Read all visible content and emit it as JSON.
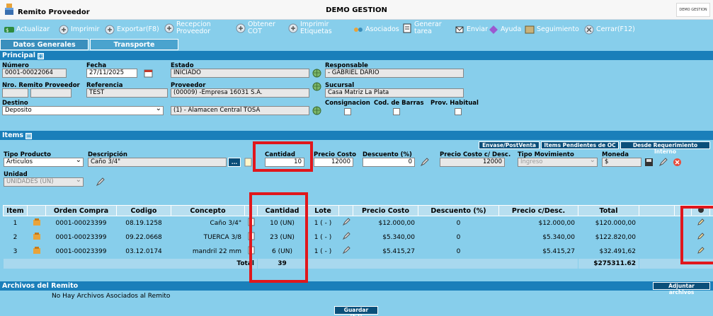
{
  "window": {
    "title": "Remito Proveedor",
    "center_title": "DEMO GESTION",
    "brand_text": "DEMO GESTION"
  },
  "toolbar": {
    "actualizar": "Actualizar",
    "imprimir": "Imprimir",
    "exportar": "Exportar(F8)",
    "recepcion_1": "Recepcion",
    "recepcion_2": "Proveedor",
    "obtener_1": "Obtener",
    "obtener_2": "COT",
    "imprimir_et_1": "Imprimir",
    "imprimir_et_2": "Etiquetas",
    "asociados": "Asociados",
    "generar_1": "Generar",
    "generar_2": "tarea",
    "enviar": "Enviar",
    "ayuda": "Ayuda",
    "seguimiento": "Seguimiento",
    "cerrar": "Cerrar(F12)"
  },
  "tabs": [
    "Datos Generales",
    "Transporte"
  ],
  "principal": {
    "section_label": "Principal",
    "numero_label": "Número",
    "numero": "0001-00022064",
    "fecha_label": "Fecha",
    "fecha": "27/11/2025",
    "estado_label": "Estado",
    "estado": "INICIADO",
    "responsable_label": "Responsable",
    "responsable": "- GABRIEL DARIO",
    "nro_remito_label": "Nro. Remito Proveedor",
    "referencia_label": "Referencia",
    "referencia": "TEST",
    "proveedor_label": "Proveedor",
    "proveedor": "(00009) -Empresa 16031 S.A.",
    "sucursal_label": "Sucursal",
    "sucursal": "Casa Matriz La Plata",
    "destino_label": "Destino",
    "destino": "Deposito",
    "almacen": "(1) - Alamacen Central TOSA",
    "consignacion_label": "Consignacion",
    "cod_barras_label": "Cod. de Barras",
    "prov_habitual_label": "Prov. Habitual"
  },
  "items": {
    "section_label": "Items",
    "btn_envase": "Envase/PostVenta",
    "btn_pendientes": "Items Pendientes de OC",
    "btn_requerimiento": "Desde Requerimiento Interno",
    "tipo_producto_label": "Tipo Producto",
    "tipo_producto": "Articulos",
    "descripcion_label": "Descripción",
    "descripcion": "Caño 3/4\"",
    "descripcion_btn": "...",
    "cantidad_label": "Cantidad",
    "cantidad": "10",
    "precio_costo_label": "Precio Costo",
    "precio_costo": "12000",
    "descuento_label": "Descuento (%)",
    "descuento": "0",
    "precio_desc_label": "Precio Costo c/ Desc.",
    "precio_desc": "12000",
    "tipo_mov_label": "Tipo Movimiento",
    "tipo_mov": "Ingreso",
    "moneda_label": "Moneda",
    "moneda": "$",
    "unidad_label": "Unidad",
    "unidad": "UNIDADES (UN)"
  },
  "grid": {
    "headers": [
      "Item",
      "",
      "Orden Compra",
      "Codigo",
      "Concepto",
      "",
      "Cantidad",
      "Lote",
      "",
      "Precio Costo",
      "Descuento (%)",
      "Precio c/Desc.",
      "Total",
      "",
      "",
      "",
      ""
    ],
    "rows": [
      {
        "item": "1",
        "orden": "0001-00023399",
        "codigo": "08.19.1258",
        "concepto": "Caño 3/4\"",
        "cantidad": "10 (UN)",
        "lote": "1 ( - )",
        "precio": "$12.000,00",
        "descuento": "0",
        "precio_desc": "$12.000,00",
        "total": "$120.000,00"
      },
      {
        "item": "2",
        "orden": "0001-00023399",
        "codigo": "09.22.0668",
        "concepto": "TUERCA 3/8",
        "cantidad": "23 (UN)",
        "lote": "1 ( - )",
        "precio": "$5.340,00",
        "descuento": "0",
        "precio_desc": "$5.340,00",
        "total": "$122.820,00"
      },
      {
        "item": "3",
        "orden": "0001-00023399",
        "codigo": "03.12.0174",
        "concepto": "mandril 22 mm",
        "cantidad": "6 (UN)",
        "lote": "1 ( - )",
        "precio": "$5.415,27",
        "descuento": "0",
        "precio_desc": "$5.415,27",
        "total": "$32.491,62"
      }
    ],
    "total_label": "Total",
    "total_cantidad": "39",
    "total_monto": "$275311.62"
  },
  "archivos": {
    "section_label": "Archivos del Remito",
    "adjuntar_btn": "Adjuntar archivos",
    "empty_text": "No Hay Archivos Asociados al Remito"
  },
  "footer": {
    "guardar": "Guardar (F2)"
  },
  "colors": {
    "background": "#87ceeb",
    "section_head": "#1a7fba",
    "highlight": "#e0171c"
  }
}
